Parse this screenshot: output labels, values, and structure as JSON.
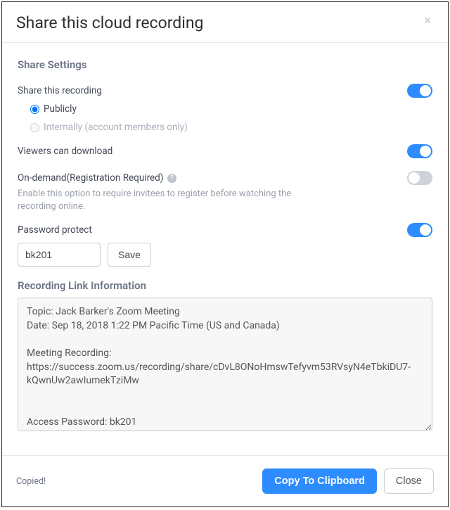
{
  "modal": {
    "title": "Share this cloud recording",
    "close": "×"
  },
  "shareSettings": {
    "heading": "Share Settings",
    "shareRecording": {
      "label": "Share this recording",
      "on": true
    },
    "visibility": {
      "public": {
        "label": "Publicly",
        "selected": true,
        "enabled": true
      },
      "internal": {
        "label": "Internally (account members only)",
        "selected": false,
        "enabled": false
      }
    },
    "download": {
      "label": "Viewers can download",
      "on": true
    },
    "onDemand": {
      "label": "On-demand(Registration Required)",
      "on": false,
      "help": "Enable this option to require invitees to register before watching the recording online."
    },
    "passwordProtect": {
      "label": "Password protect",
      "on": true,
      "value": "bk201",
      "saveLabel": "Save"
    }
  },
  "linkInfo": {
    "heading": "Recording Link Information",
    "text": "Topic: Jack Barker's Zoom Meeting\nDate: Sep 18, 2018 1:22 PM Pacific Time (US and Canada)\n\nMeeting Recording:\nhttps://success.zoom.us/recording/share/cDvL8ONoHmswTefyvm53RVsyN4eTbkiDU7-kQwnUw2awIumekTziMw\n\n\nAccess Password: bk201"
  },
  "footer": {
    "copied": "Copied!",
    "copyBtn": "Copy To Clipboard",
    "closeBtn": "Close"
  }
}
